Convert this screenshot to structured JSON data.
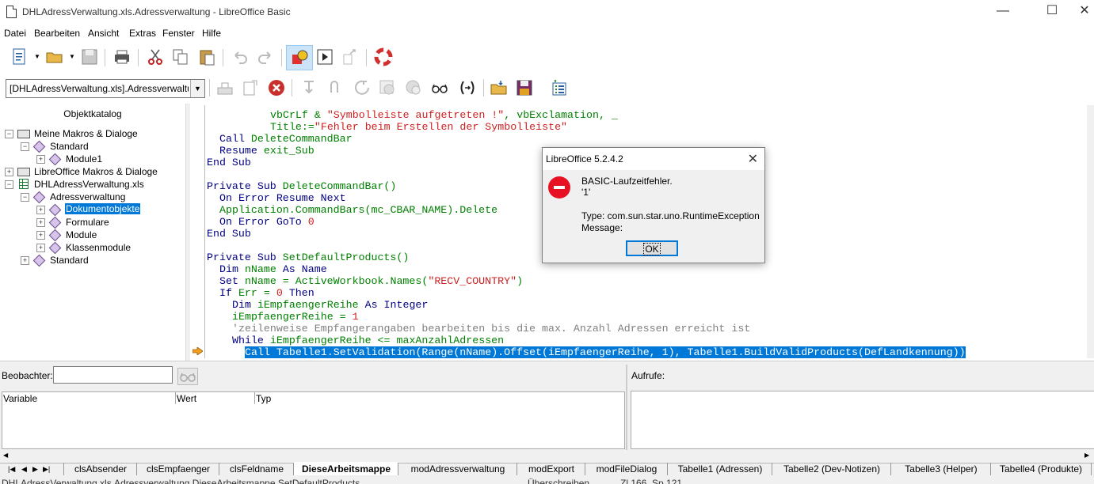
{
  "window": {
    "title": "DHLAdressVerwaltung.xls.Adressverwaltung - LibreOffice Basic",
    "minimize": "—",
    "maximize": "☐",
    "close": "✕"
  },
  "menu": [
    "Datei",
    "Bearbeiten",
    "Ansicht",
    "Extras",
    "Fenster",
    "Hilfe"
  ],
  "library_combo": {
    "value": "[DHLAdressVerwaltung.xls].Adressverwaltung"
  },
  "catalog": {
    "title": "Objektkatalog",
    "nodes": [
      {
        "label": "Meine Makros & Dialoge"
      },
      {
        "label": "Standard"
      },
      {
        "label": "Module1"
      },
      {
        "label": "LibreOffice Makros & Dialoge"
      },
      {
        "label": "DHLAdressVerwaltung.xls"
      },
      {
        "label": "Adressverwaltung"
      },
      {
        "label": "Dokumentobjekte"
      },
      {
        "label": "Formulare"
      },
      {
        "label": "Module"
      },
      {
        "label": "Klassenmodule"
      },
      {
        "label": "Standard"
      }
    ]
  },
  "code": {
    "l01a": "vbCrLf & ",
    "l01b": "\"Symbolleiste aufgetreten !\"",
    "l01c": ", vbExclamation, _",
    "l02a": "Title:=",
    "l02b": "\"Fehler beim Erstellen der Symbolleiste\"",
    "l03a": "Call",
    "l03b": "DeleteCommandBar",
    "l04a": "Resume",
    "l04b": "exit_Sub",
    "l05": "End Sub",
    "l06a": "Private Sub",
    "l06b": "DeleteCommandBar()",
    "l07": "On Error Resume Next",
    "l08a": "Application.CommandBars(mc_CBAR_NAME).Delete",
    "l09a": "On Error GoTo",
    "l09b": "0",
    "l10": "End Sub",
    "l11a": "Private Sub",
    "l11b": "SetDefaultProducts()",
    "l12a": "Dim",
    "l12b": "nName",
    "l12c": "As Name",
    "l13a": "Set",
    "l13b": "nName = ActiveWorkbook.Names(",
    "l13c": "\"RECV_COUNTRY\"",
    "l13d": ")",
    "l14a": "If",
    "l14b": "Err = ",
    "l14c": "0",
    "l14d": "Then",
    "l15a": "Dim",
    "l15b": "iEmpfaengerReihe",
    "l15c": "As Integer",
    "l16a": "iEmpfaengerReihe = ",
    "l16b": "1",
    "l17": "'zeilenweise Empfangerangaben bearbeiten bis die max. Anzahl Adressen erreicht ist",
    "l18a": "While",
    "l18b": "iEmpfaengerReihe <= maxAnzahlAdressen",
    "l19": "Call Tabelle1.SetValidation(Range(nName).Offset(iEmpfaengerReihe, 1), Tabelle1.BuildValidProducts(DefLandkennung))"
  },
  "dialog": {
    "title": "LibreOffice 5.2.4.2",
    "line1": "BASIC-Laufzeitfehler.",
    "line2": "'1'",
    "line3": "Type: com.sun.star.uno.RuntimeException",
    "line4": "Message:",
    "ok": "OK"
  },
  "watch": {
    "label": "Beobachter:",
    "columns": [
      "Variable",
      "Wert",
      "Typ"
    ]
  },
  "calls": {
    "label": "Aufrufe:"
  },
  "tabs": [
    "clsAbsender",
    "clsEmpfaenger",
    "clsFeldname",
    "DieseArbeitsmappe",
    "modAdressverwaltung",
    "modExport",
    "modFileDialog",
    "Tabelle1 (Adressen)",
    "Tabelle2 (Dev-Notizen)",
    "Tabelle3 (Helper)",
    "Tabelle4 (Produkte)"
  ],
  "active_tab": "DieseArbeitsmappe",
  "status": {
    "left": "DHLAdressVerwaltung.xls.Adressverwaltung.DieseArbeitsmappe.SetDefaultProducts",
    "mode": "Überschreiben",
    "position": "Zl 166, Sp 121"
  }
}
